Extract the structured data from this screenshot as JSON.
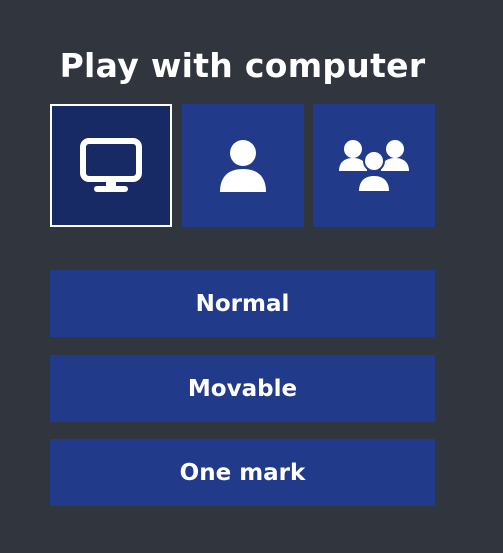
{
  "title": "Play with computer",
  "colors": {
    "background": "#31353d",
    "tile": "#213a8a",
    "tile_selected": "#182a66",
    "text": "#ffffff"
  },
  "modes": [
    {
      "icon": "monitor-icon",
      "selected": true
    },
    {
      "icon": "user-icon",
      "selected": false
    },
    {
      "icon": "users-group-icon",
      "selected": false
    }
  ],
  "options": [
    {
      "label": "Normal"
    },
    {
      "label": "Movable"
    },
    {
      "label": "One mark"
    }
  ]
}
